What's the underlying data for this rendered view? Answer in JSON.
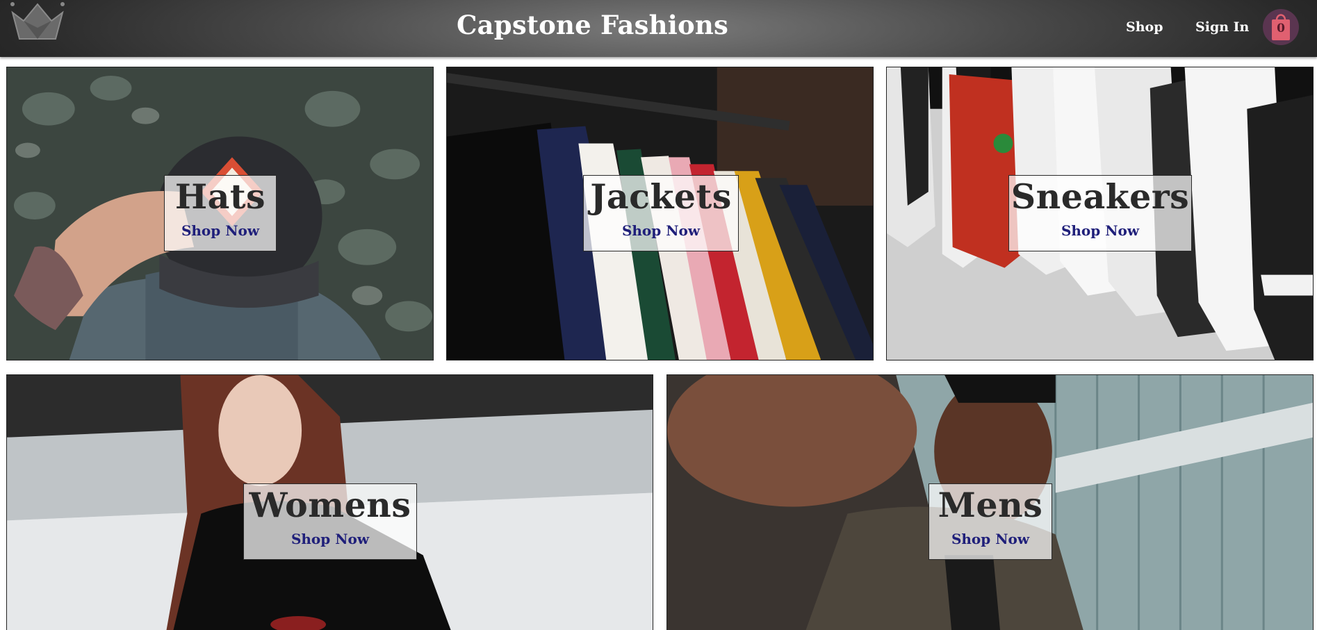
{
  "header": {
    "brand": "Capstone Fashions",
    "logo_icon": "crown-icon",
    "nav": [
      {
        "label": "Shop"
      },
      {
        "label": "Sign In"
      }
    ],
    "cart": {
      "icon": "shopping-bag-icon",
      "count": "0"
    }
  },
  "categories": [
    {
      "title": "Hats",
      "cta": "Shop Now"
    },
    {
      "title": "Jackets",
      "cta": "Shop Now"
    },
    {
      "title": "Sneakers",
      "cta": "Shop Now"
    },
    {
      "title": "Womens",
      "cta": "Shop Now"
    },
    {
      "title": "Mens",
      "cta": "Shop Now"
    }
  ],
  "colors": {
    "header_dark": "#1e1e1e",
    "cta": "#1f1f7a",
    "cart_bubble": "#5a3550",
    "cart_bag": "#e06070"
  }
}
